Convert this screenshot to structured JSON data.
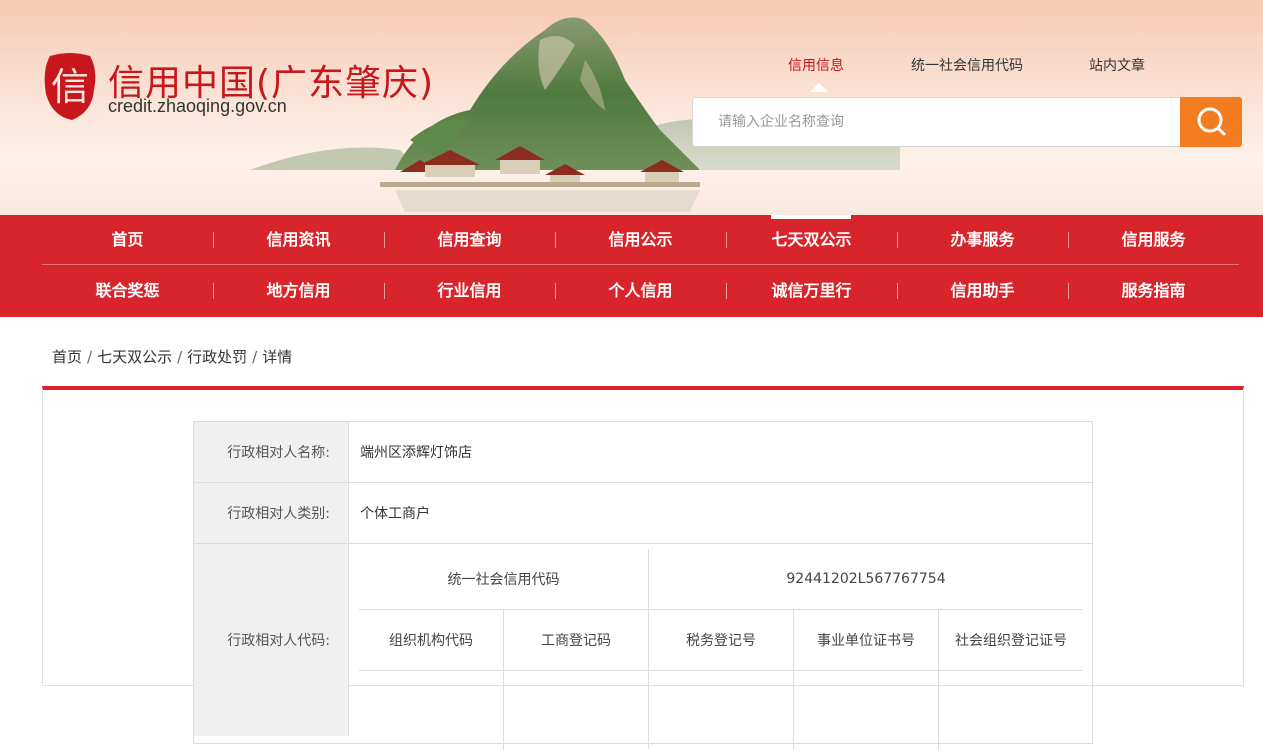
{
  "header": {
    "logo_char": "信",
    "title": "信用中国(广东肇庆)",
    "url": "credit.zhaoqing.gov.cn",
    "top_links": [
      {
        "label": "信用信息",
        "active": true
      },
      {
        "label": "统一社会信用代码",
        "active": false
      },
      {
        "label": "站内文章",
        "active": false
      }
    ],
    "search": {
      "placeholder": "请输入企业名称查询"
    }
  },
  "nav": {
    "row1": [
      "首页",
      "信用资讯",
      "信用查询",
      "信用公示",
      "七天双公示",
      "办事服务",
      "信用服务"
    ],
    "row2": [
      "联合奖惩",
      "地方信用",
      "行业信用",
      "个人信用",
      "诚信万里行",
      "信用助手",
      "服务指南"
    ],
    "active": "七天双公示"
  },
  "breadcrumb": [
    "首页",
    "七天双公示",
    "行政处罚",
    "详情"
  ],
  "detail": {
    "name_label": "行政相对人名称:",
    "name_value": "端州区添辉灯饰店",
    "type_label": "行政相对人类别:",
    "type_value": "个体工商户",
    "code_label": "行政相对人代码:",
    "code_table": {
      "usc_label": "统一社会信用代码",
      "usc_value": "92441202L567767754",
      "headers": [
        "组织机构代码",
        "工商登记码",
        "税务登记号",
        "事业单位证书号",
        "社会组织登记证号"
      ]
    }
  },
  "colors": {
    "brand_red": "#d8242b",
    "search_orange": "#f47c20",
    "logo_red": "#c8161d"
  }
}
